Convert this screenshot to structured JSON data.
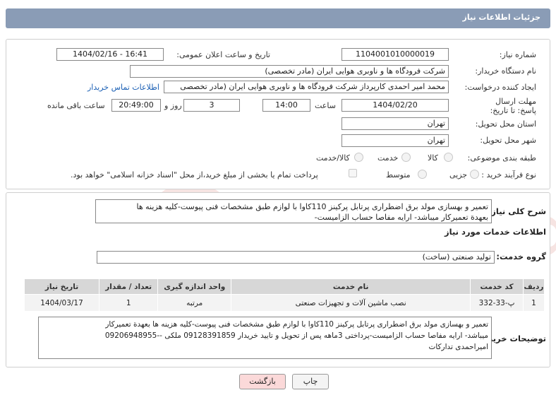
{
  "header": {
    "title": "جزئیات اطلاعات نیاز"
  },
  "form": {
    "need_number_label": "شماره نیاز:",
    "need_number": "1104001010000019",
    "announce_label": "تاریخ و ساعت اعلان عمومی:",
    "announce_value": "1404/02/16 - 16:41",
    "buyer_org_label": "نام دستگاه خریدار:",
    "buyer_org": "شرکت فرودگاه ها و ناوبری هوایی ایران (مادر تخصصی)",
    "creator_label": "ایجاد کننده درخواست:",
    "creator": "محمد امیر احمدی کارپرداز شرکت فرودگاه ها و ناوبری هوایی ایران (مادر تخصصی",
    "contact_link": "اطلاعات تماس خریدار",
    "deadline_label": "مهلت ارسال پاسخ: تا تاریخ:",
    "deadline_date": "1404/02/20",
    "time_label": "ساعت",
    "deadline_time": "14:00",
    "days_value": "3",
    "days_label": "روز و",
    "remaining_time": "20:49:00",
    "remaining_label": "ساعت باقی مانده",
    "province_label": "استان محل تحویل:",
    "province": "تهران",
    "city_label": "شهر محل تحویل:",
    "city": "تهران",
    "category_label": "طبقه بندی موضوعی:",
    "category_options": [
      "کالا",
      "خدمت",
      "کالا/خدمت"
    ],
    "process_label": "نوع فرآیند خرید :",
    "process_options": [
      "جزیی",
      "متوسط"
    ],
    "payment_note": "پرداخت تمام یا بخشی از مبلغ خرید،از محل \"اسناد خزانه اسلامی\" خواهد بود."
  },
  "details": {
    "summary_label": "شرح کلی نیاز:",
    "summary_line1": "تعمیر و بهسازی مولد برق اضطراری پرتابل پرکینز 110کاوا با لوازم طبق مشخصات فنی پیوست-کلیه هزینه ها",
    "summary_line2": "بعهدة تعمیرکار میباشد- ارایه مفاصا حساب الزامیست-",
    "services_info_label": "اطلاعات خدمات مورد نیاز",
    "service_group_label": "گروه خدمت:",
    "service_group": "تولید صنعتی (ساخت)"
  },
  "table": {
    "headers": [
      "ردیف",
      "کد خدمت",
      "نام خدمت",
      "واحد اندازه گیری",
      "تعداد / مقدار",
      "تاریخ نیاز"
    ],
    "rows": [
      [
        "1",
        "پ-33-332",
        "نصب ماشین آلات و تجهیزات صنعتی",
        "مرتبه",
        "1",
        "1404/03/17"
      ]
    ]
  },
  "buyer_notes": {
    "label": "توضیحات خریدار:",
    "line1": "تعمیر و بهسازی مولد برق اضطراری پرتابل پرکینز 110کاوا با لوازم طبق مشخصات فنی پیوست-کلیه هزینه ها بعهدة تعمیرکار",
    "line2": "میباشد- ارایه مفاصا حساب الزامیست-پرداختی 3ماهه پس از تحویل و تایید خریدار 09128391859 ملکی --09206948955",
    "line3": "امیراحمدی تدارکات"
  },
  "buttons": {
    "print": "چاپ",
    "back": "بازگشت"
  },
  "watermark_text": "AriaTender.net",
  "colors": {
    "header": "#8a9cb6",
    "link": "#1a5fb4",
    "back_button": "#fbd9d9"
  }
}
